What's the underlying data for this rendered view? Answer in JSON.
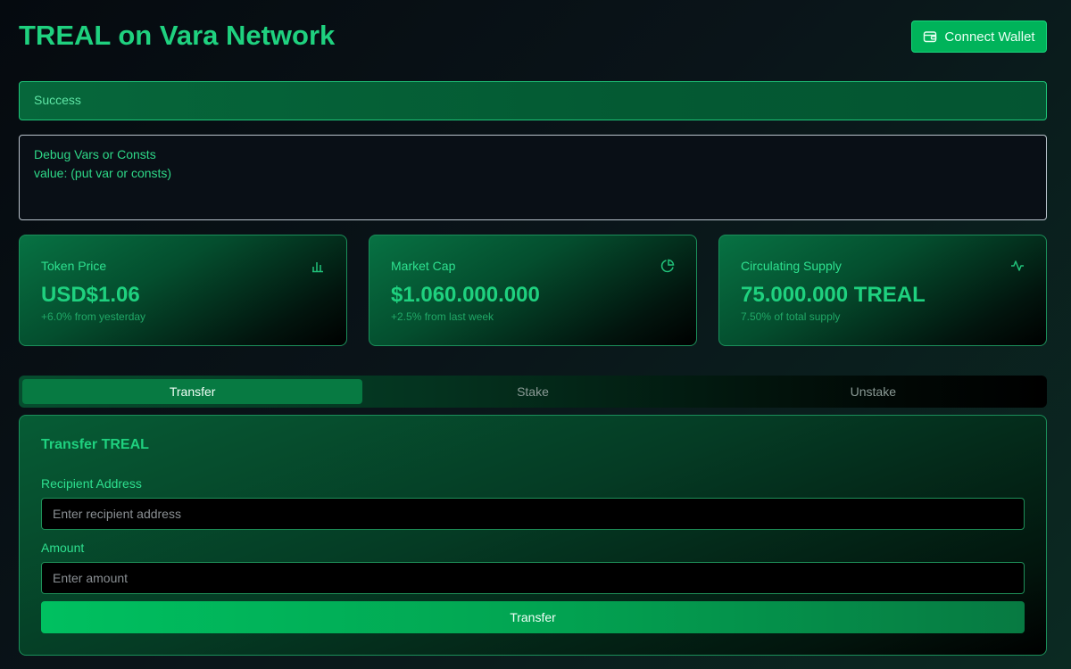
{
  "header": {
    "title": "TREAL on Vara Network",
    "connect_label": "Connect Wallet"
  },
  "alert": {
    "text": "Success"
  },
  "debug": {
    "line1": "Debug Vars or Consts",
    "line2": "value: (put var or consts)"
  },
  "stats": [
    {
      "label": "Token Price",
      "value": "USD$1.06",
      "sub": "+6.0% from yesterday",
      "icon": "bar-chart-icon"
    },
    {
      "label": "Market Cap",
      "value": "$1.060.000.000",
      "sub": "+2.5% from last week",
      "icon": "pie-chart-icon"
    },
    {
      "label": "Circulating Supply",
      "value": "75.000.000 TREAL",
      "sub": "7.50% of total supply",
      "icon": "activity-icon"
    }
  ],
  "tabs": [
    {
      "label": "Transfer",
      "active": true
    },
    {
      "label": "Stake",
      "active": false
    },
    {
      "label": "Unstake",
      "active": false
    }
  ],
  "transfer": {
    "title": "Transfer TREAL",
    "recipient_label": "Recipient Address",
    "recipient_placeholder": "Enter recipient address",
    "recipient_value": "",
    "amount_label": "Amount",
    "amount_placeholder": "Enter amount",
    "amount_value": "",
    "submit_label": "Transfer"
  },
  "colors": {
    "accent": "#1fd17f",
    "button": "#00b35a",
    "active_tab": "#077a42"
  }
}
